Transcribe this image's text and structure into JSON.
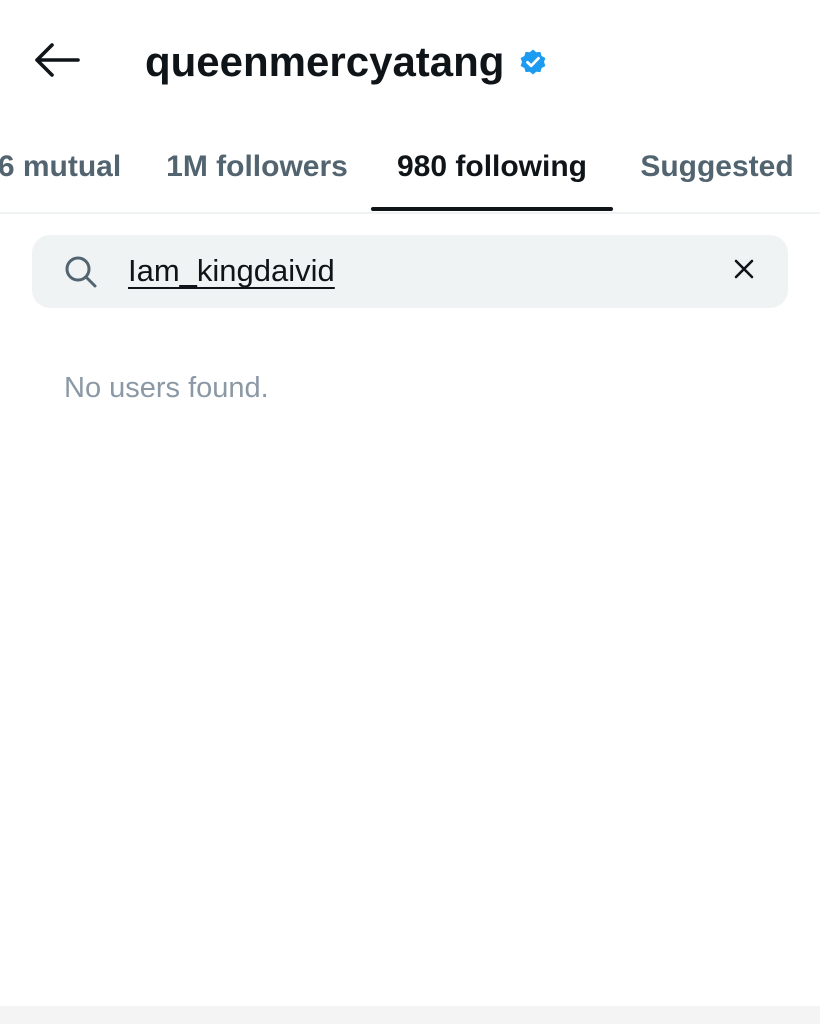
{
  "header": {
    "back_icon": "arrow-left-icon",
    "title": "queenmercyatang",
    "verified_icon": "verified-badge-icon",
    "verified_color": "#1d9bf0"
  },
  "tabs": [
    {
      "label": "6 mutual",
      "active": false
    },
    {
      "label": "1M followers",
      "active": false
    },
    {
      "label": "980 following",
      "active": true
    },
    {
      "label": "Suggested",
      "active": false
    }
  ],
  "search": {
    "icon": "search-icon",
    "value": "Iam_kingdaivid",
    "clear_icon": "close-icon"
  },
  "results": {
    "empty_text": "No users found."
  },
  "colors": {
    "text_primary": "#0f1419",
    "text_secondary": "#536471",
    "muted": "#8b98a5",
    "search_bg": "#eff3f4",
    "accent": "#1d9bf0"
  }
}
